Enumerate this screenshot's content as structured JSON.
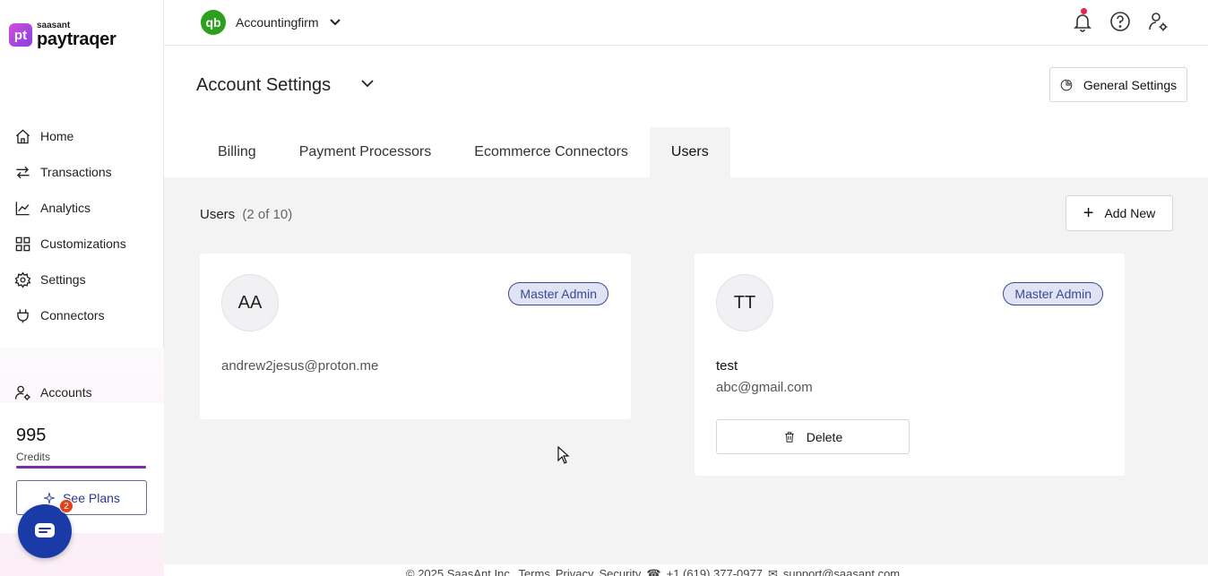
{
  "brand": {
    "mark": "pt",
    "small": "saasant",
    "name": "paytraqer"
  },
  "sidebar": {
    "items": [
      {
        "label": "Home",
        "icon": "home-icon"
      },
      {
        "label": "Transactions",
        "icon": "transactions-icon"
      },
      {
        "label": "Analytics",
        "icon": "analytics-icon"
      },
      {
        "label": "Customizations",
        "icon": "customizations-icon"
      },
      {
        "label": "Settings",
        "icon": "gear-icon"
      },
      {
        "label": "Connectors",
        "icon": "plug-icon"
      }
    ],
    "accounts_label": "Accounts",
    "credits": {
      "value": "995",
      "label": "Credits"
    },
    "see_plans_label": "See Plans",
    "chat_badge": "2"
  },
  "topbar": {
    "qb_mark": "qb",
    "company": "Accountingfirm"
  },
  "header": {
    "title": "Account Settings",
    "general_settings_label": "General Settings"
  },
  "tabs": [
    {
      "label": "Billing",
      "active": false
    },
    {
      "label": "Payment Processors",
      "active": false
    },
    {
      "label": "Ecommerce Connectors",
      "active": false
    },
    {
      "label": "Users",
      "active": true
    }
  ],
  "users": {
    "heading": "Users",
    "count": "(2 of 10)",
    "add_label": "Add New",
    "list": [
      {
        "initials": "AA",
        "role": "Master Admin",
        "name": "",
        "email": "andrew2jesus@proton.me"
      },
      {
        "initials": "TT",
        "role": "Master Admin",
        "name": "test",
        "email": "abc@gmail.com",
        "delete_label": "Delete"
      }
    ]
  },
  "footer": {
    "copyright": "© 2025 SaasAnt Inc.",
    "links": [
      "Terms",
      "Privacy",
      "Security"
    ],
    "phone": "+1 (619) 377-0977",
    "email": "support@saasant.com"
  },
  "colors": {
    "accent": "#3c4a8f",
    "brand": "#8a3fe0",
    "qb_green": "#2ca01c",
    "chat": "#1a3aa8"
  }
}
